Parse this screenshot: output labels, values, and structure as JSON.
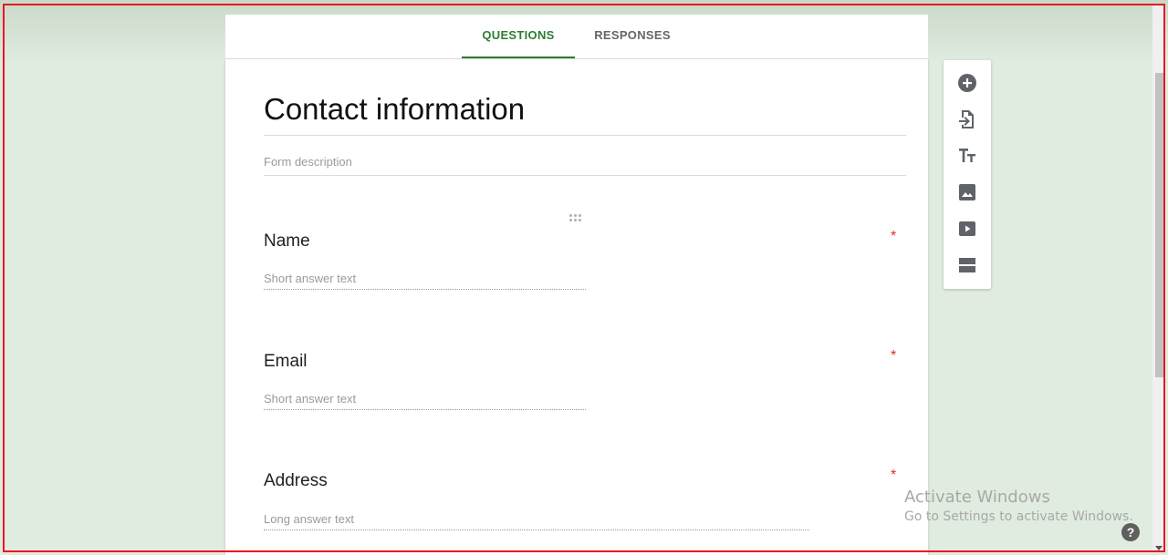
{
  "tabs": {
    "questions": "QUESTIONS",
    "responses": "RESPONSES"
  },
  "form": {
    "title": "Contact information",
    "description_placeholder": "Form description"
  },
  "questions": [
    {
      "title": "Name",
      "required_marker": "*",
      "answer_hint": "Short answer text"
    },
    {
      "title": "Email",
      "required_marker": "*",
      "answer_hint": "Short answer text"
    },
    {
      "title": "Address",
      "required_marker": "*",
      "answer_hint": "Long answer text"
    }
  ],
  "toolbar": {
    "icons": [
      "add-question-icon",
      "import-questions-icon",
      "add-title-icon",
      "add-image-icon",
      "add-video-icon",
      "add-section-icon"
    ]
  },
  "watermark": {
    "line1": "Activate Windows",
    "line2": "Go to Settings to activate Windows."
  },
  "help": {
    "label": "?"
  },
  "colors": {
    "accent": "#2e7d32",
    "required": "#d93025",
    "background": "#e0ece0"
  }
}
